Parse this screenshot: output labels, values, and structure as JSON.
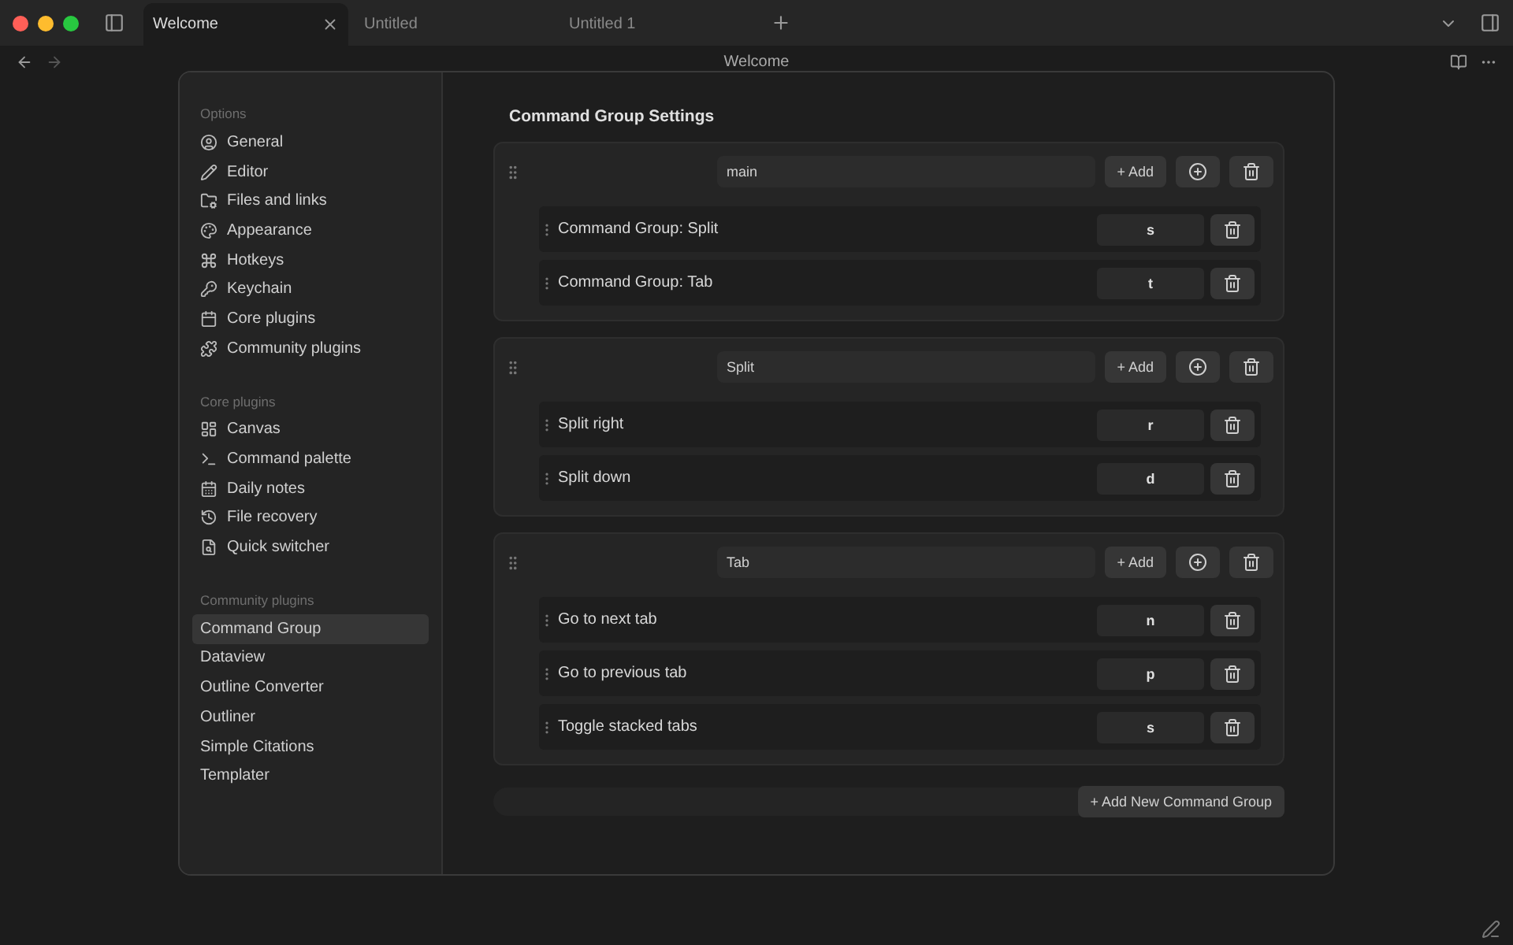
{
  "window": {
    "tabs": [
      {
        "label": "Welcome",
        "selected": true
      },
      {
        "label": "Untitled",
        "selected": false
      },
      {
        "label": "Untitled 1",
        "selected": false
      }
    ],
    "title": "Welcome"
  },
  "sidebar": {
    "sections": [
      {
        "heading": "Options",
        "items": [
          {
            "label": "General",
            "selected": false
          },
          {
            "label": "Editor",
            "selected": false
          },
          {
            "label": "Files and links",
            "selected": false
          },
          {
            "label": "Appearance",
            "selected": false
          },
          {
            "label": "Hotkeys",
            "selected": false
          },
          {
            "label": "Keychain",
            "selected": false
          },
          {
            "label": "Core plugins",
            "selected": false
          },
          {
            "label": "Community plugins",
            "selected": false
          }
        ]
      },
      {
        "heading": "Core plugins",
        "items": [
          {
            "label": "Canvas",
            "selected": false
          },
          {
            "label": "Command palette",
            "selected": false
          },
          {
            "label": "Daily notes",
            "selected": false
          },
          {
            "label": "File recovery",
            "selected": false
          },
          {
            "label": "Quick switcher",
            "selected": false
          }
        ]
      },
      {
        "heading": "Community plugins",
        "items": [
          {
            "label": "Command Group",
            "selected": true
          },
          {
            "label": "Dataview",
            "selected": false
          },
          {
            "label": "Outline Converter",
            "selected": false
          },
          {
            "label": "Outliner",
            "selected": false
          },
          {
            "label": "Simple Citations",
            "selected": false
          },
          {
            "label": "Templater",
            "selected": false
          }
        ]
      }
    ]
  },
  "settings": {
    "heading": "Command Group Settings",
    "groups": [
      {
        "name": "main",
        "add_label": "+ Add",
        "commands": [
          {
            "name": "Command Group: Split",
            "hotkey": "s"
          },
          {
            "name": "Command Group: Tab",
            "hotkey": "t"
          }
        ]
      },
      {
        "name": "Split",
        "add_label": "+ Add",
        "commands": [
          {
            "name": "Split right",
            "hotkey": "r"
          },
          {
            "name": "Split down",
            "hotkey": "d"
          }
        ]
      },
      {
        "name": "Tab",
        "add_label": "+ Add",
        "commands": [
          {
            "name": "Go to next tab",
            "hotkey": "n"
          },
          {
            "name": "Go to previous tab",
            "hotkey": "p"
          },
          {
            "name": "Toggle stacked tabs",
            "hotkey": "s"
          }
        ]
      }
    ],
    "add_group_label": "+ Add New Command Group"
  }
}
